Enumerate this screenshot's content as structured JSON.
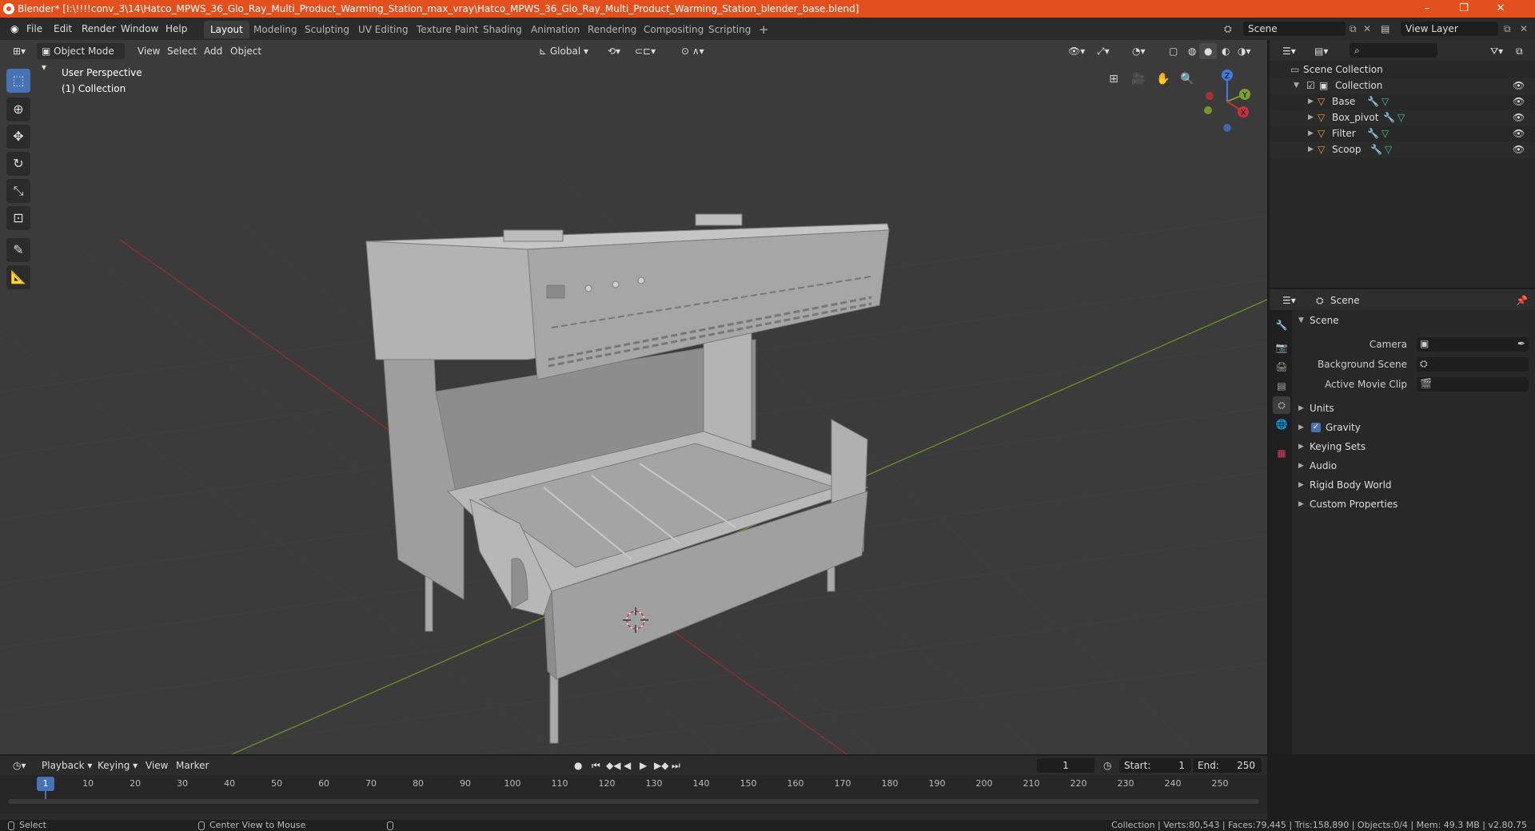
{
  "window": {
    "title": "Blender* [I:\\!!!!conv_3\\14\\Hatco_MPWS_36_Glo_Ray_Multi_Product_Warming_Station_max_vray\\Hatco_MPWS_36_Glo_Ray_Multi_Product_Warming_Station_blender_base.blend]",
    "minimize": "–",
    "restore": "❐",
    "close": "✕"
  },
  "menu": [
    "File",
    "Edit",
    "Render",
    "Window",
    "Help"
  ],
  "workspaces": [
    "Layout",
    "Modeling",
    "Sculpting",
    "UV Editing",
    "Texture Paint",
    "Shading",
    "Animation",
    "Rendering",
    "Compositing",
    "Scripting"
  ],
  "workspace_add": "+",
  "scene_field": "Scene",
  "view_layer_field": "View Layer",
  "viewport": {
    "mode": "Object Mode",
    "menus": [
      "View",
      "Select",
      "Add",
      "Object"
    ],
    "orientation": "Global",
    "overlay_line1": "User Perspective",
    "overlay_line2": "(1) Collection",
    "gizmo": {
      "x": "X",
      "y": "Y",
      "z": "Z"
    }
  },
  "outliner": {
    "scene_collection": "Scene Collection",
    "collection": "Collection",
    "items": [
      "Base",
      "Box_pivot",
      "Filter",
      "Scoop"
    ]
  },
  "properties": {
    "header": "Scene",
    "panel": "Scene",
    "camera_label": "Camera",
    "bg_scene_label": "Background Scene",
    "movie_clip_label": "Active Movie Clip",
    "sections": [
      "Units",
      "Gravity",
      "Keying Sets",
      "Audio",
      "Rigid Body World",
      "Custom Properties"
    ]
  },
  "timeline": {
    "menus": [
      "Playback",
      "Keying",
      "View",
      "Marker"
    ],
    "current_frame": "1",
    "start_label": "Start:",
    "start": "1",
    "end_label": "End:",
    "end": "250",
    "ticks": [
      "1",
      "10",
      "20",
      "30",
      "40",
      "50",
      "60",
      "70",
      "80",
      "90",
      "100",
      "110",
      "120",
      "130",
      "140",
      "150",
      "160",
      "170",
      "180",
      "190",
      "200",
      "210",
      "220",
      "230",
      "240",
      "250"
    ]
  },
  "status": {
    "select": "Select",
    "center_view": "Center View to Mouse",
    "stats": "Collection | Verts:80,543 | Faces:79,445 | Tris:158,890 | Objects:0/4 | Mem: 49.3 MB | v2.80.75"
  },
  "colors": {
    "accent": "#4772b3",
    "titlebar": "#e3501e",
    "viewport_bg": "#3b3b3b",
    "x_axis": "#c8313f",
    "y_axis": "#7da02c",
    "z_axis": "#3f7ce0"
  }
}
